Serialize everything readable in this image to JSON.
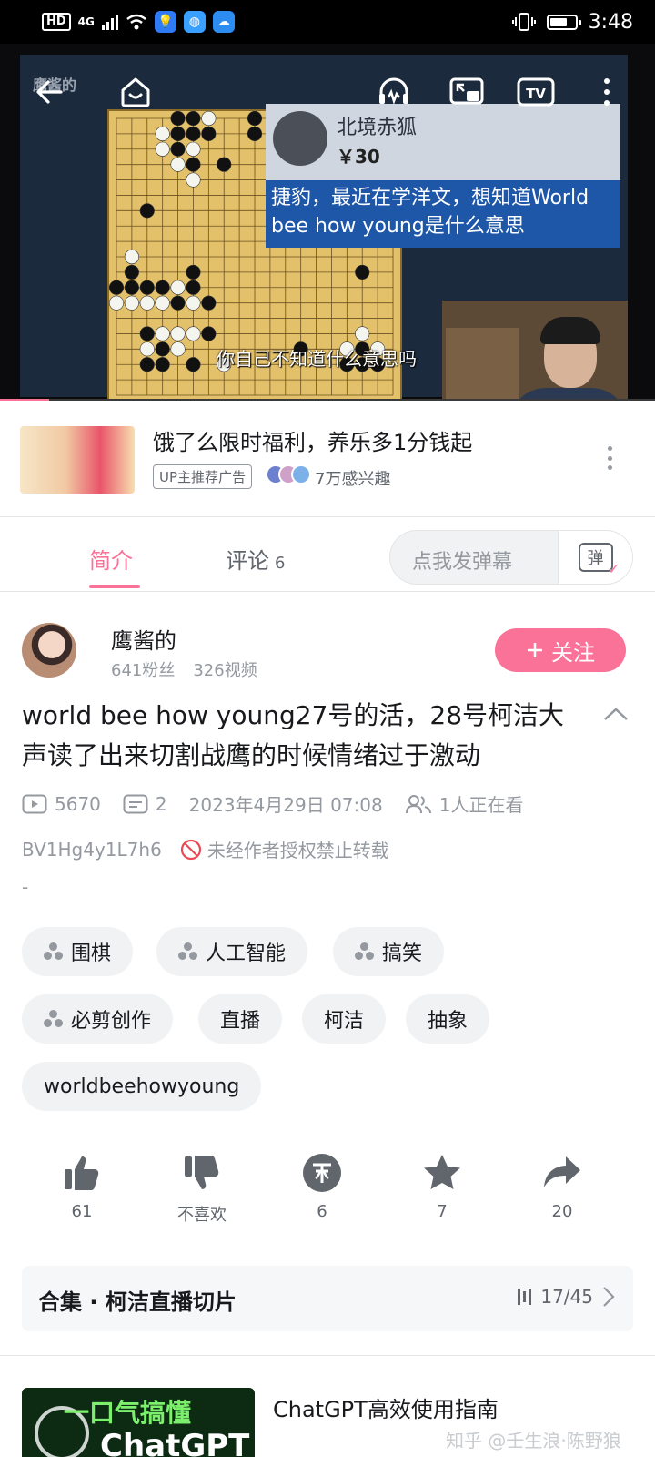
{
  "status_bar": {
    "hd": "HD",
    "network": "4G",
    "time": "3:48"
  },
  "video": {
    "watermark": "鹰酱的",
    "chat": {
      "user": "北境赤狐",
      "price": "￥30",
      "message": "捷豹，最近在学洋文，想知道World bee how young是什么意思"
    },
    "subtitle": "你自己不知道什么意思吗",
    "icons": [
      "back-icon",
      "home-icon",
      "listen-icon",
      "pip-icon",
      "cast-tv-icon",
      "more-icon"
    ]
  },
  "ad": {
    "title": "饿了么限时福利，养乐多1分钱起",
    "tag": "UP主推荐广告",
    "interest": "7万感兴趣"
  },
  "tabs": {
    "intro": "简介",
    "comments": "评论",
    "comments_count": "6",
    "danmaku_placeholder": "点我发弹幕",
    "danmaku_button": "弹"
  },
  "uploader": {
    "name": "鹰酱的",
    "fans": "641粉丝",
    "videos": "326视频",
    "follow": "关注"
  },
  "video_info": {
    "title": "world bee how young27号的活，28号柯洁大声读了出来切割战鹰的时候情绪过于激动",
    "plays": "5670",
    "danmaku": "2",
    "date": "2023年4月29日 07:08",
    "watching": "1人正在看",
    "bvid": "BV1Hg4y1L7h6",
    "no_reprint": "未经作者授权禁止转载",
    "desc": "-"
  },
  "tags": [
    "围棋",
    "人工智能",
    "搞笑",
    "必剪创作",
    "直播",
    "柯洁",
    "抽象",
    "worldbeehowyoung"
  ],
  "actions": {
    "like": "61",
    "dislike": "不喜欢",
    "coin": "6",
    "favorite": "7",
    "share": "20"
  },
  "collection": {
    "title": "合集 · 柯洁直播切片",
    "progress": "17/45"
  },
  "recommend": {
    "thumb_top": "一口气搞懂",
    "thumb_bottom": "ChatGPT",
    "title": "ChatGPT高效使用指南"
  },
  "watermark": "知乎 @壬生浪·陈野狼",
  "colors": {
    "accent": "#fb7299",
    "text": "#18191c",
    "secondary": "#9499a0"
  }
}
